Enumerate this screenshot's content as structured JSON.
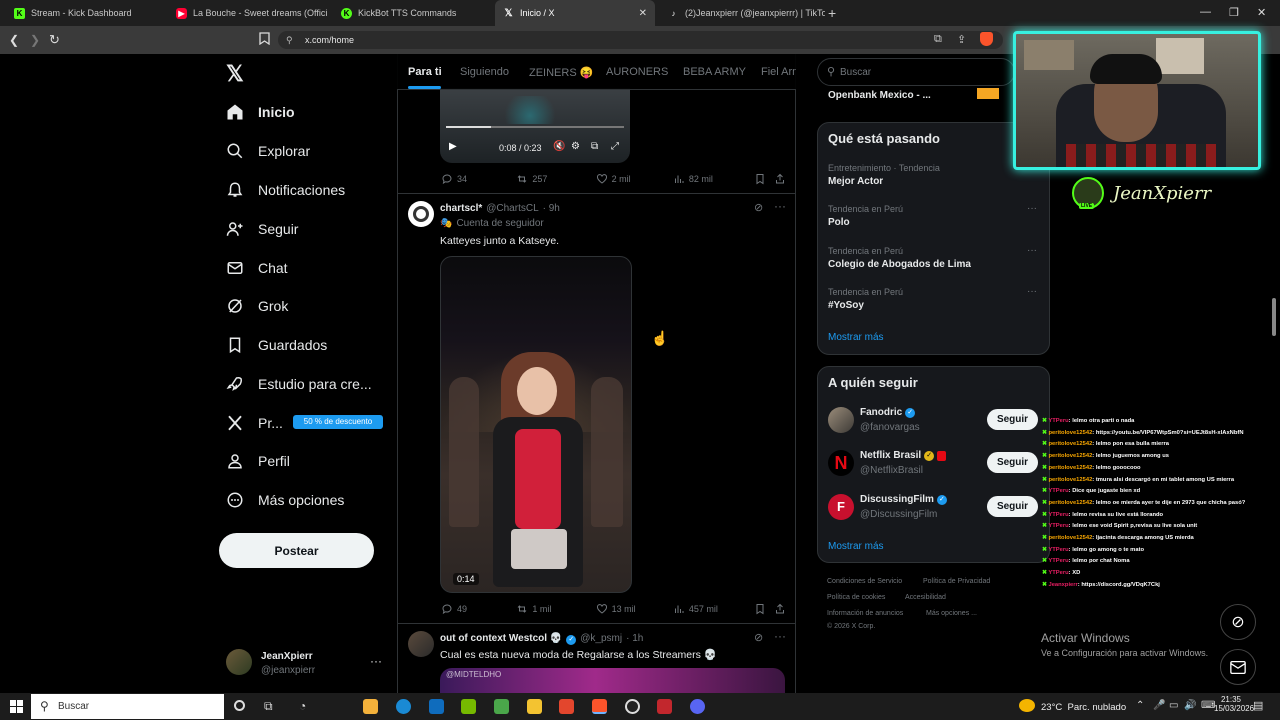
{
  "browser": {
    "tabs": [
      {
        "title": "Stream - Kick Dashboard",
        "icon": "kick-icon",
        "color": "#53fc18"
      },
      {
        "title": "La Bouche - Sweet dreams (Offici",
        "icon": "youtube-icon",
        "color": "#ff0033"
      },
      {
        "title": "KickBot TTS Commands",
        "icon": "kickbot-icon",
        "color": "#53fc18"
      },
      {
        "title": "Inicio / X",
        "icon": "x-icon",
        "color": "#000000",
        "active": true
      },
      {
        "title": "(2)Jeanxpierr (@jeanxpierrr) | TikTok",
        "icon": "tiktok-icon",
        "color": "#000000"
      }
    ],
    "url": "x.com/home"
  },
  "sidebar": {
    "items": [
      {
        "label": "Inicio",
        "icon": "home-icon",
        "bold": true
      },
      {
        "label": "Explorar",
        "icon": "search-icon"
      },
      {
        "label": "Notificaciones",
        "icon": "bell-icon"
      },
      {
        "label": "Seguir",
        "icon": "person-plus-icon"
      },
      {
        "label": "Chat",
        "icon": "mail-icon"
      },
      {
        "label": "Grok",
        "icon": "grok-icon"
      },
      {
        "label": "Guardados",
        "icon": "bookmark-icon"
      },
      {
        "label": "Estudio para cre...",
        "icon": "rocket-icon"
      },
      {
        "label": "Pr...",
        "icon": "x-logo-icon"
      },
      {
        "label": "Perfil",
        "icon": "person-icon"
      },
      {
        "label": "Más opciones",
        "icon": "more-circle-icon"
      }
    ],
    "promo": "50 % de descuento",
    "post_button": "Postear",
    "account": {
      "name": "JeanXpierr",
      "handle": "@jeanxpierr"
    }
  },
  "feed_tabs": [
    "Para ti",
    "Siguiendo",
    "ZEINERS 😝",
    "AURONERS",
    "BEBA ARMY",
    "Fiel Arn"
  ],
  "tweets": [
    {
      "video_time": "0:08 / 0:23",
      "replies": "34",
      "reposts": "257",
      "likes": "2 mil",
      "views": "82 mil"
    },
    {
      "name": "chartscl*",
      "handle": "@ChartsCL",
      "time": "· 9h",
      "badge": "Cuenta de seguidor",
      "text": "Katteyes junto a Katseye.",
      "video_duration": "0:14",
      "replies": "49",
      "reposts": "1 mil",
      "likes": "13 mil",
      "views": "457 mil"
    },
    {
      "name": "out of context Westcol 💀",
      "handle": "@k_psmj",
      "time": "· 1h",
      "text": "Cual es esta nueva moda de Regalarse a los Streamers 💀",
      "media_watermark": "@MIDTELDHO"
    }
  ],
  "right": {
    "search_placeholder": "Buscar",
    "promoted": "Openbank Mexico - ...",
    "trends_title": "Qué está pasando",
    "trends": [
      {
        "category": "Entretenimiento · Tendencia",
        "name": "Mejor Actor"
      },
      {
        "category": "Tendencia en Perú",
        "name": "Polo"
      },
      {
        "category": "Tendencia en Perú",
        "name": "Colegio de Abogados de Lima"
      },
      {
        "category": "Tendencia en Perú",
        "name": "#YoSoy"
      }
    ],
    "trends_more": "Mostrar más",
    "follow_title": "A quién seguir",
    "follow": [
      {
        "name": "Fanodric",
        "handle": "@fanovargas",
        "button": "Seguir"
      },
      {
        "name": "Netflix Brasil",
        "handle": "@NetflixBrasil",
        "button": "Seguir"
      },
      {
        "name": "DiscussingFilm",
        "handle": "@DiscussingFilm",
        "button": "Seguir"
      }
    ],
    "follow_more": "Mostrar más",
    "footer": [
      "Condiciones de Servicio",
      "Política de Privacidad",
      "Política de cookies",
      "Accesibilidad",
      "Información de anuncios",
      "Más opciones ...",
      "© 2026 X Corp."
    ]
  },
  "overlay": {
    "streamer_name": "JeanXpierr",
    "live_badge": "LIVE",
    "chat": [
      {
        "user": "YTPeru",
        "msg": ": lelmo otra parti o nada"
      },
      {
        "user": "peritolove12542",
        "msg": ": https://youtu.be/VIP67WtpSm0?si=UEJt8sH-xlAxNbfN"
      },
      {
        "user": "peritolove12542",
        "msg": ": lelmo pon esa bulla mierra"
      },
      {
        "user": "peritolove12542",
        "msg": ": lelmo juguemos among us"
      },
      {
        "user": "peritolove12542",
        "msg": ": lelmo gooocooo"
      },
      {
        "user": "peritolove12542",
        "msg": ": tmura alsi descargó en mi tablet among US mierra"
      },
      {
        "user": "YTPeru",
        "msg": ": Dice que jugaste bien xd"
      },
      {
        "user": "peritolove12542",
        "msg": ": lelmo oe mierda ayer te dije en 2973 que chicha pasó?"
      },
      {
        "user": "YTPeru",
        "msg": ": lelmo revisa su live está llorando"
      },
      {
        "user": "YTPeru",
        "msg": ": lelmo ese void Spirit p,revisa su live sola unit"
      },
      {
        "user": "peritolove12542",
        "msg": ": ljacinta descarga among US mierda"
      },
      {
        "user": "YTPeru",
        "msg": ": lelmo go among o te mato"
      },
      {
        "user": "YTPeru",
        "msg": ": lelmo por chat Noma"
      },
      {
        "user": "YTPeru",
        "msg": ": XD"
      },
      {
        "user": "Jeanxpierr",
        "msg": ": https://discord.gg/VDqK7Ckj"
      }
    ],
    "activate_title": "Activar Windows",
    "activate_sub": "Ve a Configuración para activar Windows."
  },
  "taskbar": {
    "search": "Buscar",
    "weather": "23°C  Parc. nublado",
    "time": "21:35",
    "date": "15/03/2026"
  },
  "colors": {
    "accent": "#1d9bf0",
    "background": "#000000",
    "kick": "#53fc18"
  }
}
